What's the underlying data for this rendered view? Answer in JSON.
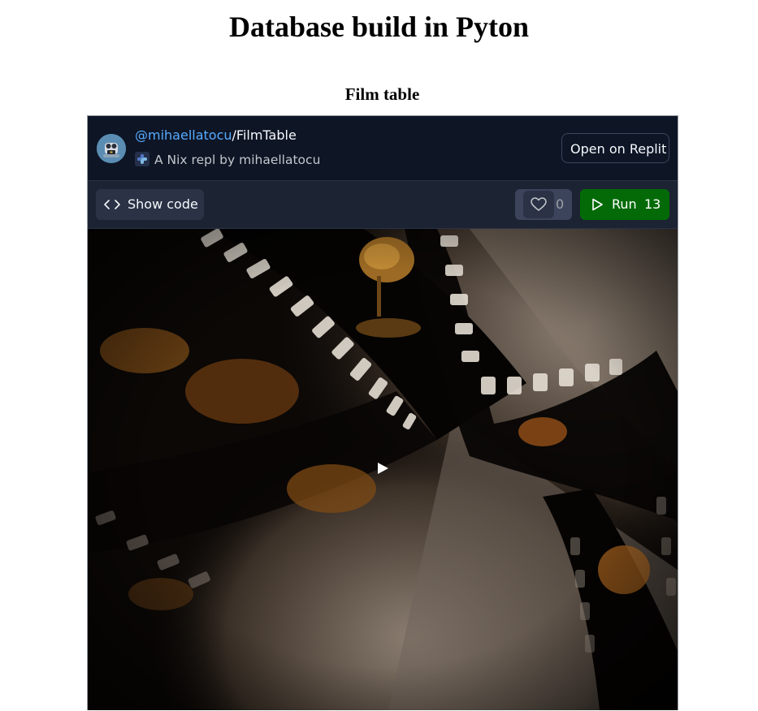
{
  "page": {
    "title": "Database build in Pyton",
    "section_title": "Film table"
  },
  "embed": {
    "owner": "@mihaellatocu",
    "separator": "/",
    "repl_name": "FilmTable",
    "subtitle": "A Nix repl by mihaellatocu",
    "open_label": "Open on Replit",
    "show_code_label": "Show code",
    "like_count": "0",
    "run_label": "Run",
    "run_count": "13",
    "icons": {
      "avatar": "robot-avatar-icon",
      "language": "nix-icon",
      "code": "code-brackets-icon",
      "like": "heart-icon",
      "run": "play-outline-icon",
      "cover_play": "play-icon"
    },
    "colors": {
      "background": "#0e1525",
      "toolbar": "#1c2333",
      "owner_link": "#57abff",
      "run_button": "#036a07"
    }
  }
}
